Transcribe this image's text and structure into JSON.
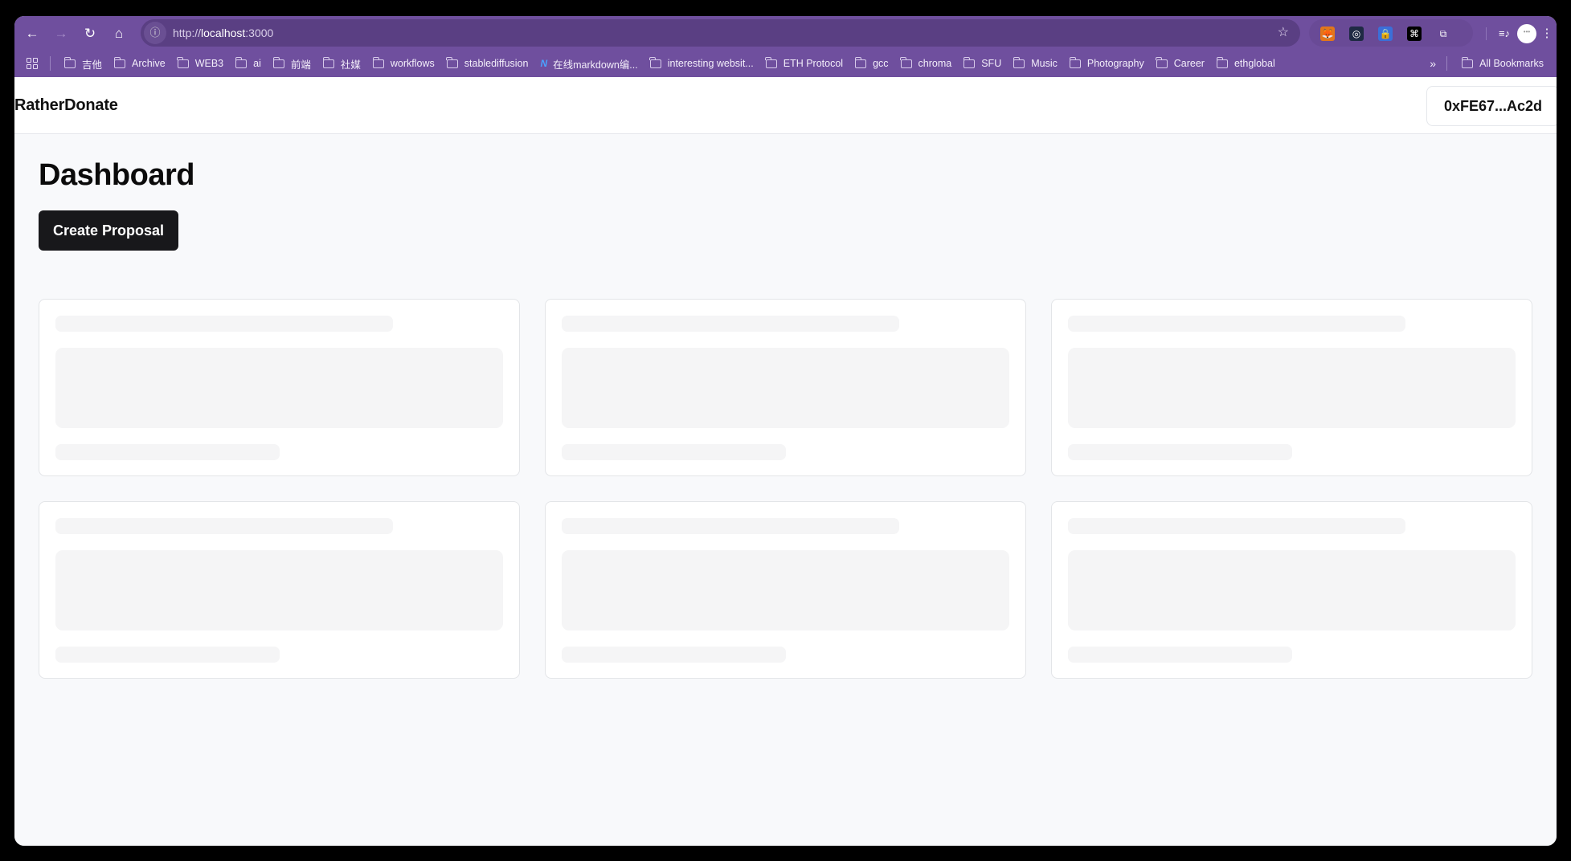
{
  "browser": {
    "url_prefix": "http://",
    "url_host": "localhost",
    "url_port": ":3000",
    "nav": {
      "back_icon": "←",
      "forward_icon": "→",
      "reload_icon": "↻",
      "home_icon": "⌂",
      "info_icon": "ⓘ",
      "star_icon": "☆"
    },
    "extensions": [
      {
        "name": "metamask-extension-icon",
        "glyph": "🦊",
        "color": "#e2761b"
      },
      {
        "name": "openai-extension-icon",
        "glyph": "◎",
        "color": "#1f2a44"
      },
      {
        "name": "vpn-extension-icon",
        "glyph": "🔒",
        "color": "#3b6fd8"
      },
      {
        "name": "grid-extension-icon",
        "glyph": "⌘",
        "color": "#000000"
      },
      {
        "name": "extensions-puzzle-icon",
        "glyph": "⧉",
        "color": "transparent"
      }
    ],
    "toolbar_right": {
      "media_icon": "≡♪",
      "profile_icon": "•••",
      "menu_icon": "⋮"
    },
    "bookmarks": [
      {
        "label": "吉他",
        "icon": "folder"
      },
      {
        "label": "Archive",
        "icon": "folder"
      },
      {
        "label": "WEB3",
        "icon": "folder"
      },
      {
        "label": "ai",
        "icon": "folder"
      },
      {
        "label": "前端",
        "icon": "folder"
      },
      {
        "label": "社媒",
        "icon": "folder"
      },
      {
        "label": "workflows",
        "icon": "folder"
      },
      {
        "label": "stablediffusion",
        "icon": "folder"
      },
      {
        "label": "在线markdown编...",
        "icon": "markdown"
      },
      {
        "label": "interesting websit...",
        "icon": "folder"
      },
      {
        "label": "ETH Protocol",
        "icon": "folder"
      },
      {
        "label": "gcc",
        "icon": "folder"
      },
      {
        "label": "chroma",
        "icon": "folder"
      },
      {
        "label": "SFU",
        "icon": "folder"
      },
      {
        "label": "Music",
        "icon": "folder"
      },
      {
        "label": "Photography",
        "icon": "folder"
      },
      {
        "label": "Career",
        "icon": "folder"
      },
      {
        "label": "ethglobal",
        "icon": "folder"
      }
    ],
    "bookmarks_more": "»",
    "all_bookmarks": "All Bookmarks"
  },
  "app": {
    "brand": "RatherDonate",
    "wallet_address": "0xFE67...Ac2d",
    "page_title": "Dashboard",
    "create_button": "Create Proposal",
    "proposal_cards_loading": 6
  }
}
